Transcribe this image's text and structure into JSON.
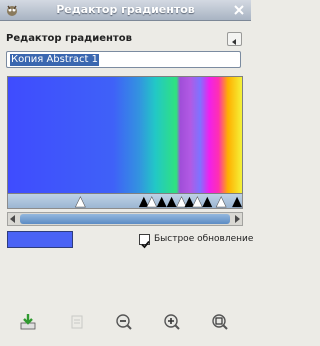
{
  "window": {
    "title": "Редактор градиентов"
  },
  "panel": {
    "title": "Редактор градиентов"
  },
  "gradient": {
    "name": "Копия Abstract 1",
    "current_color": "#4a63f5"
  },
  "options": {
    "instant_update_label": "Быстрое обновление",
    "instant_update_checked": true
  },
  "toolbar": {
    "icons": [
      "save-icon",
      "revert-icon",
      "zoom-out-icon",
      "zoom-in-icon",
      "zoom-fit-icon"
    ]
  }
}
